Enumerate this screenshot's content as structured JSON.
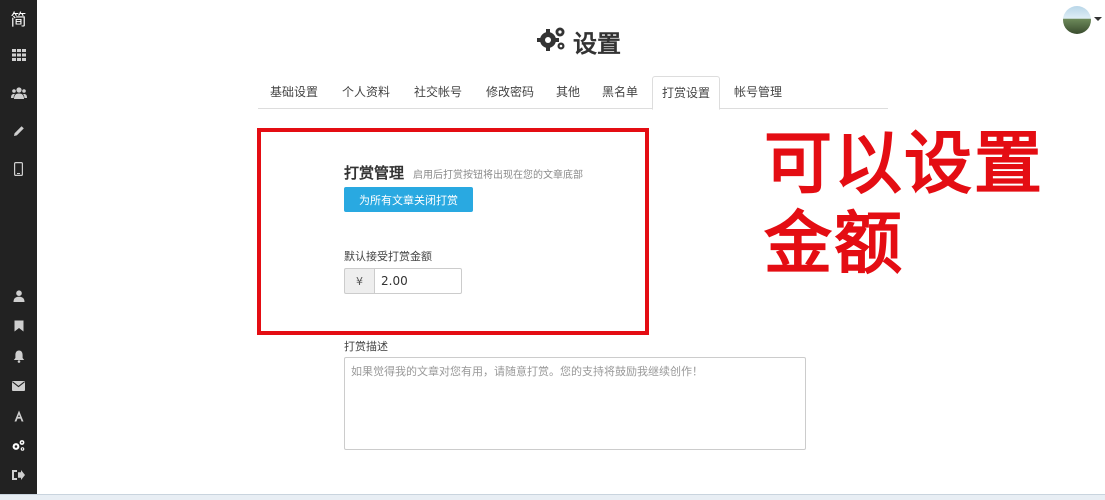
{
  "sidebar": {
    "logo": "简",
    "top_icons": [
      "apps-icon",
      "users-icon",
      "pencil-icon",
      "mobile-icon"
    ],
    "bottom_icons": [
      "user-icon",
      "bookmark-icon",
      "bell-icon",
      "mail-icon",
      "font-icon",
      "settings-icon",
      "logout-icon"
    ]
  },
  "header": {
    "title": "设置",
    "title_icon": "gears-icon"
  },
  "tabs": [
    {
      "label": "基础设置",
      "active": false
    },
    {
      "label": "个人资料",
      "active": false
    },
    {
      "label": "社交帐号",
      "active": false
    },
    {
      "label": "修改密码",
      "active": false
    },
    {
      "label": "其他",
      "active": false
    },
    {
      "label": "黑名单",
      "active": false
    },
    {
      "label": "打赏设置",
      "active": true
    },
    {
      "label": "帐号管理",
      "active": false
    }
  ],
  "reward": {
    "title": "打赏管理",
    "hint": "启用后打赏按钮将出现在您的文章底部",
    "close_button": "为所有文章关闭打赏",
    "amount_label": "默认接受打赏金额",
    "currency": "¥",
    "amount_value": "2.00",
    "desc_label": "打赏描述",
    "desc_placeholder": "如果觉得我的文章对您有用，请随意打赏。您的支持将鼓励我继续创作！"
  },
  "annotation": {
    "line1": "可以设置",
    "line2": "金额"
  },
  "colors": {
    "sidebar": "#222222",
    "accent": "#29a9e1",
    "annotation_red": "#e40d13"
  }
}
